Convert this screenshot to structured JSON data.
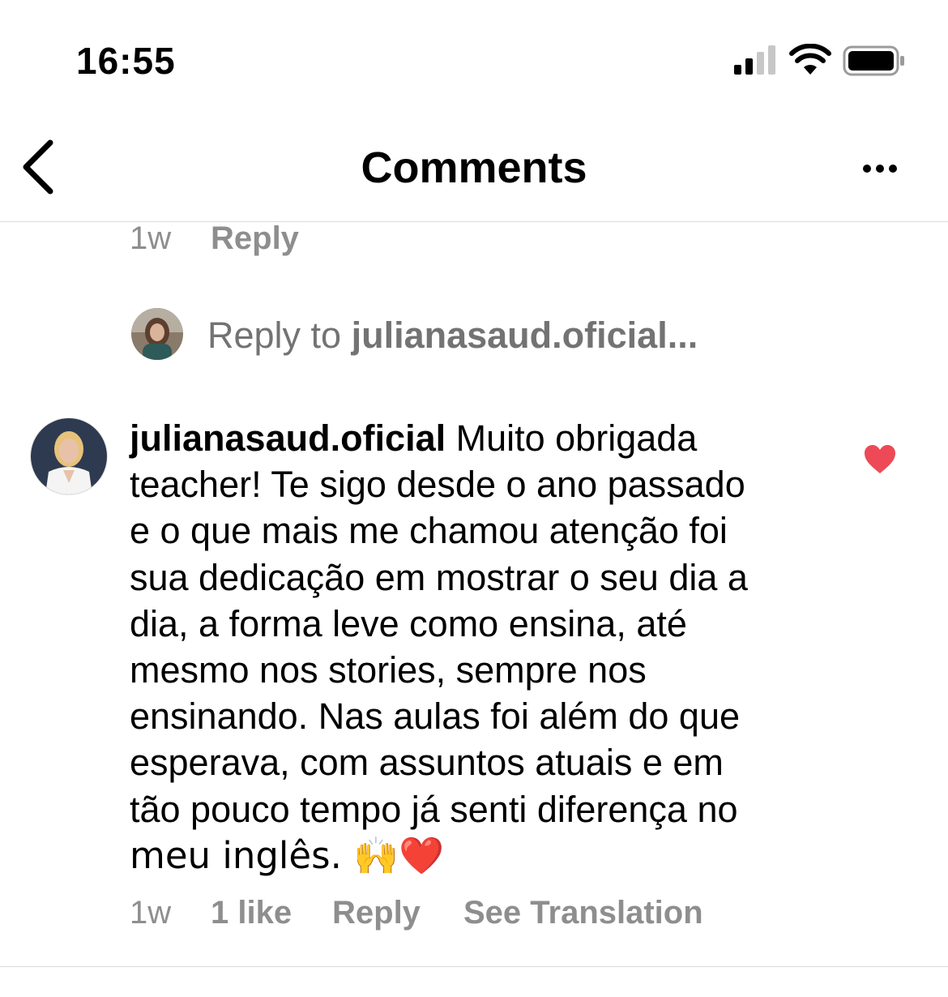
{
  "status_bar": {
    "time": "16:55",
    "signal_icon": "cellular-signal-icon",
    "wifi_icon": "wifi-icon",
    "battery_icon": "battery-icon"
  },
  "header": {
    "title": "Comments",
    "back_icon": "chevron-left-icon",
    "more_icon": "more-horizontal-icon"
  },
  "previous_comment": {
    "time": "1w",
    "reply_label": "Reply"
  },
  "reply_composer": {
    "prefix": "Reply to ",
    "username": "julianasaud.oficial..."
  },
  "comment": {
    "username": "julianasaud.oficial",
    "lines": [
      " Muito obrigada",
      "teacher! Te sigo desde o ano passado",
      "e o que mais me chamou atenção foi",
      "sua dedicação em mostrar o seu dia a",
      "dia, a forma leve como ensina, até",
      "mesmo nos stories, sempre nos",
      "ensinando. Nas aulas foi além do que",
      "esperava, com assuntos atuais  e em",
      "tão pouco tempo já senti diferença no",
      "meu inglês. 🙌❤️"
    ],
    "liked": true,
    "like_color": "#ed4956",
    "time": "1w",
    "likes": "1 like",
    "reply_label": "Reply",
    "translate_label": "See Translation"
  }
}
